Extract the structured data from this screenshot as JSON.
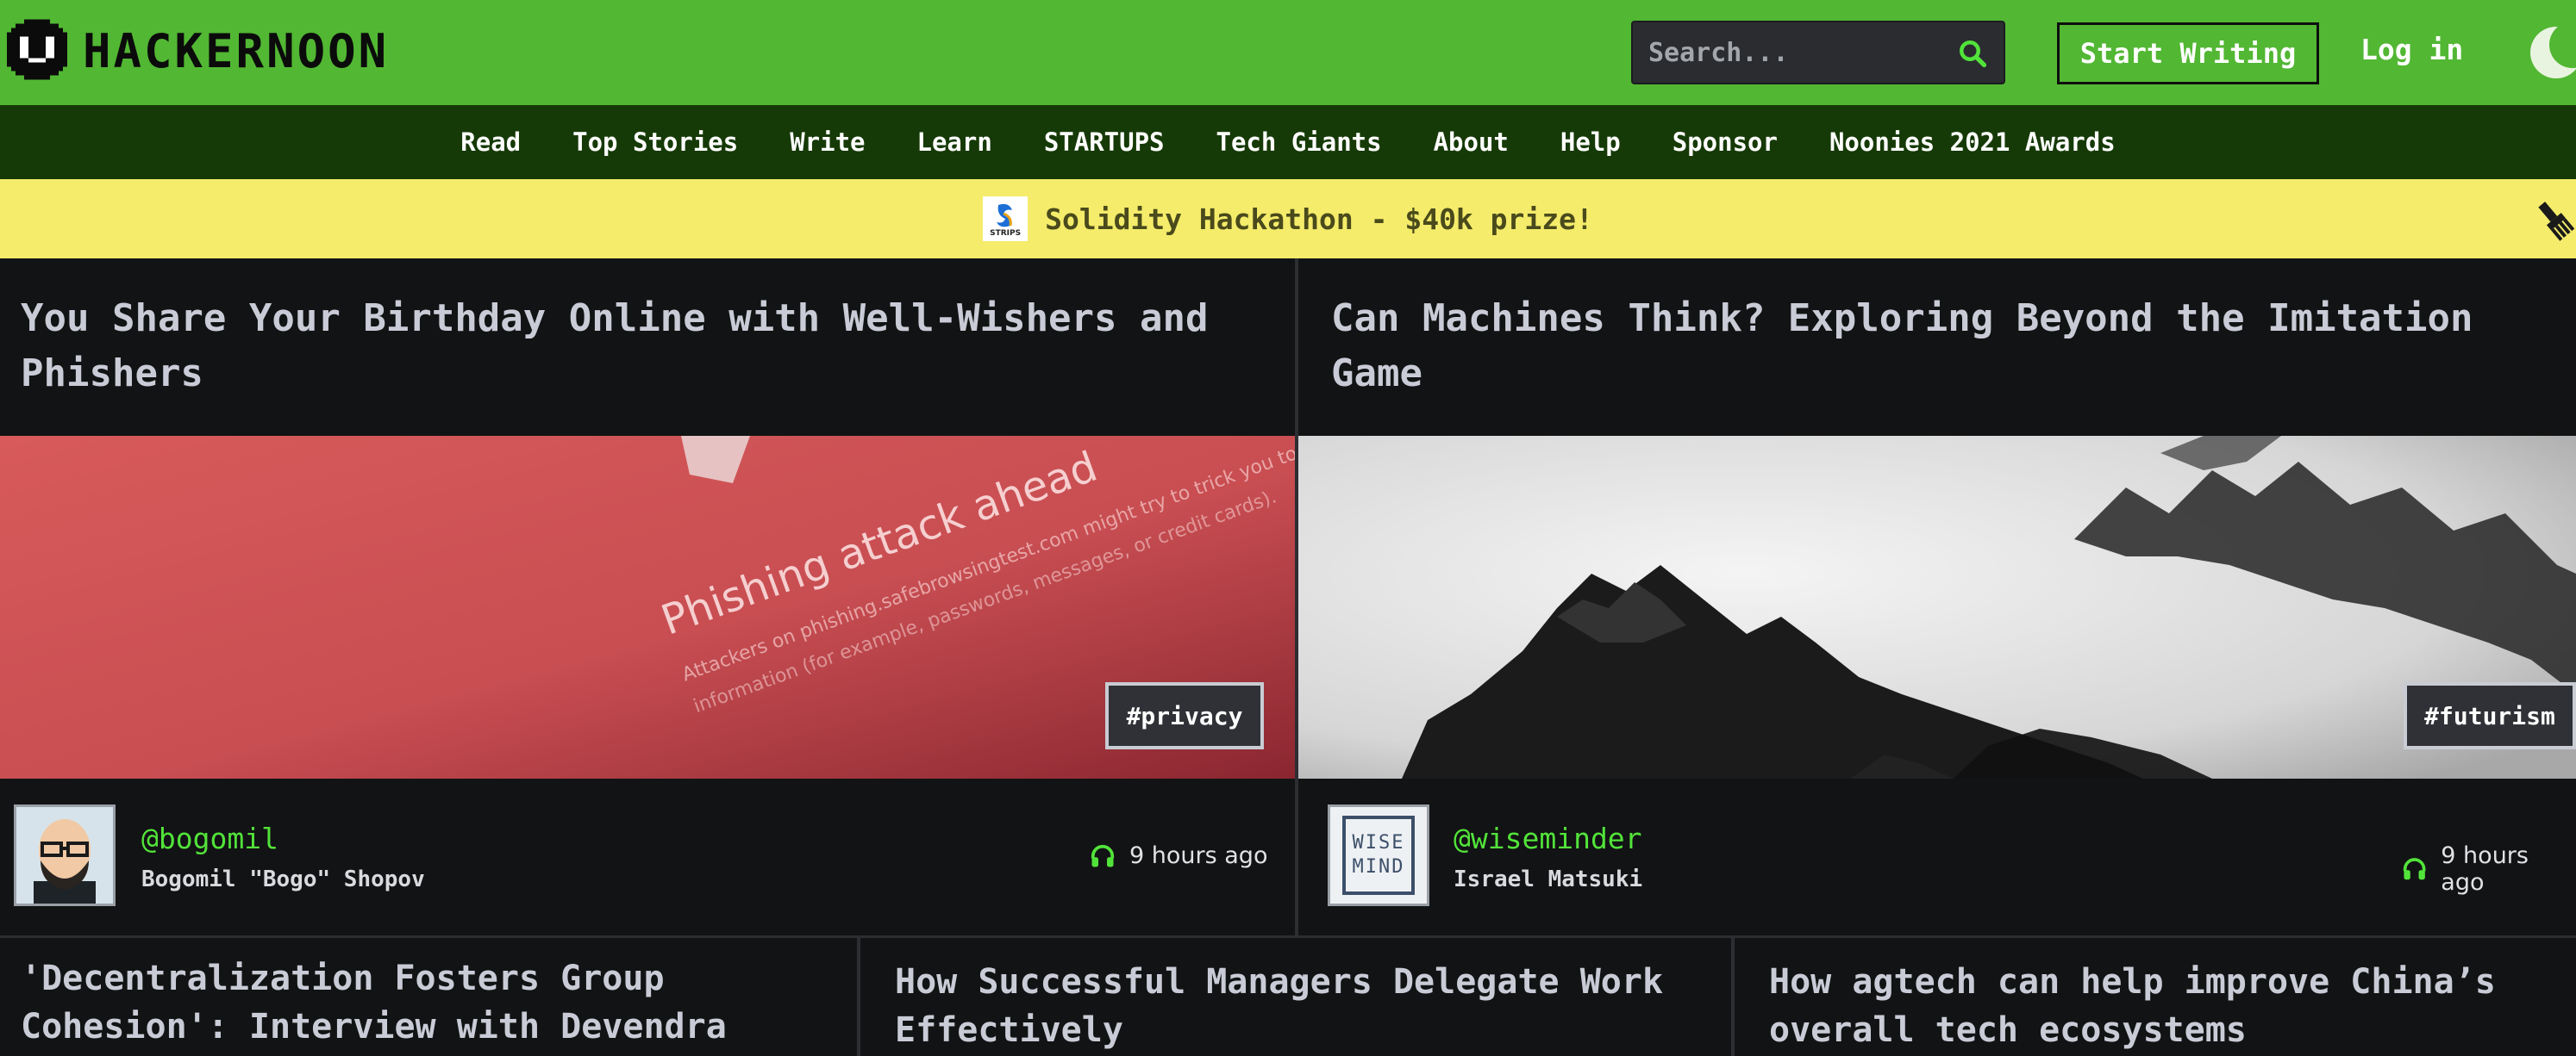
{
  "header": {
    "logo_text": "HACKERNOON",
    "search_placeholder": "Search...",
    "start_writing": "Start Writing",
    "login": "Log in"
  },
  "nav": {
    "items": [
      "Read",
      "Top Stories",
      "Write",
      "Learn",
      "STARTUPS",
      "Tech Giants",
      "About",
      "Help",
      "Sponsor",
      "Noonies 2021 Awards"
    ]
  },
  "promo": {
    "logo_text": "STRIPS",
    "text": "Solidity Hackathon - $40k prize!"
  },
  "featured": [
    {
      "title": "You Share Your Birthday Online with Well-Wishers and Phishers",
      "image_text": {
        "headline": "Phishing attack ahead",
        "line1": "Attackers on phishing.safebrowsingtest.com might try to trick you to steal your",
        "line2": "information (for example, passwords, messages, or credit cards)."
      },
      "tag": "#privacy",
      "handle": "@bogomil",
      "author": "Bogomil \"Bogo\" Shopov",
      "time": "9 hours ago"
    },
    {
      "title": "Can Machines Think? Exploring Beyond the Imitation Game",
      "tag": "#futurism",
      "handle": "@wiseminder",
      "author": "Israel Matsuki",
      "avatar_text": [
        "WISE",
        "MIND"
      ],
      "time": "9 hours ago"
    }
  ],
  "stories": [
    {
      "title": "'Decentralization Fosters Group Cohesion': Interview with Devendra"
    },
    {
      "title": "How Successful Managers Delegate Work Effectively"
    },
    {
      "title": "How agtech can help improve China’s overall tech ecosystems"
    }
  ],
  "colors": {
    "brand_green": "#52b733",
    "nav_dark_green": "#163a07",
    "promo_yellow": "#f4ec6a",
    "background": "#121314",
    "handle_green": "#52e33a"
  }
}
